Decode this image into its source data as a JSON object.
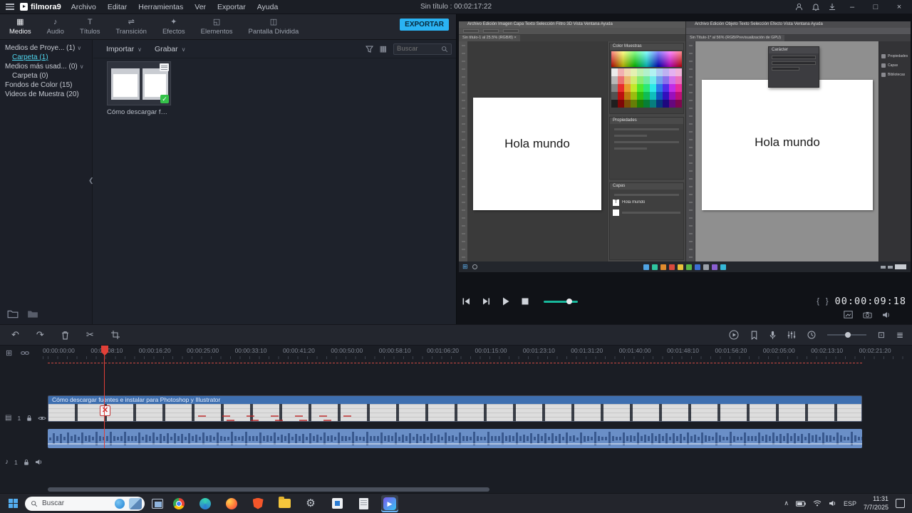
{
  "colors": {
    "accent": "#2ab3f3",
    "selection": "#4fd6ee",
    "playhead_red": "#e04038",
    "clip_label_bg": "#3e6fb0",
    "audio_clip": "#6a8fc7",
    "taskbar_bg": "#23252c"
  },
  "menubar": {
    "logo": "filmora9",
    "menus": [
      "Archivo",
      "Editar",
      "Herramientas",
      "Ver",
      "Exportar",
      "Ayuda"
    ],
    "title": "Sin título : 00:02:17:22",
    "window_buttons": {
      "minimize": "–",
      "maximize": "□",
      "close": "×"
    }
  },
  "tabbar": {
    "tabs": [
      {
        "icon": "▦",
        "label": "Medios"
      },
      {
        "icon": "♪",
        "label": "Audio"
      },
      {
        "icon": "T",
        "label": "Títulos"
      },
      {
        "icon": "⇌",
        "label": "Transición"
      },
      {
        "icon": "✦",
        "label": "Efectos"
      },
      {
        "icon": "◱",
        "label": "Elementos"
      },
      {
        "icon": "◫",
        "label": "Pantalla Dividida"
      }
    ],
    "export_label": "EXPORTAR"
  },
  "media": {
    "sidebar": {
      "project_media": "Medios de Proye... (1)",
      "folder1": "Carpeta (1)",
      "most_used": "Medios más usad... (0)",
      "folder0": "Carpeta (0)",
      "color_backgrounds": "Fondos de Color (15)",
      "sample_videos": "Videos de Muestra (20)"
    },
    "import_label": "Importar",
    "record_label": "Grabar",
    "search_placeholder": "Buscar",
    "item_label": "Cómo descargar fuente..."
  },
  "preview": {
    "timecode": "00:00:09:18"
  },
  "video_content": {
    "ps_menu": "Archivo   Edición   Imagen   Capa   Texto   Selección   Filtro   3D   Vista   Ventana   Ayuda",
    "ps_tab": "Sin título-1 al 25.5% (RGB/8) ×",
    "ps_canvas_text": "Hola mundo",
    "ps_swatches_tabs": "Color   Muestras",
    "ps_properties": "Propiedades",
    "ps_layers": "Capas",
    "ps_layer_name": "Hola mundo",
    "ai_menu": "Archivo   Edición   Objeto   Texto   Selección   Efecto   Vista   Ventana   Ayuda",
    "ai_tab": "Sin Título-1* al 56% (RGB/Previsualización de GPU)",
    "ai_canvas_text": "Hola mundo",
    "ai_character_panel": "Carácter",
    "ai_dock": [
      "Propiedades",
      "Capas",
      "Bibliotecas"
    ]
  },
  "timeline": {
    "ruler_labels": [
      "00:00:00:00",
      "00:00:08:10",
      "00:00:16:20",
      "00:00:25:00",
      "00:00:33:10",
      "00:00:41:20",
      "00:00:50:00",
      "00:00:58:10",
      "00:01:06:20",
      "00:01:15:00",
      "00:01:23:10",
      "00:01:31:20",
      "00:01:40:00",
      "00:01:48:10",
      "00:01:56:20",
      "00:02:05:00",
      "00:02:13:10",
      "00:02:21:20"
    ],
    "clip_label": "Cómo descargar fuentes e instalar para Photoshop y Illustrator",
    "video_track_number": "1",
    "audio_track_number": "1"
  },
  "taskbar": {
    "search_placeholder": "Buscar",
    "language": "ESP",
    "time": "11:31",
    "date": "7/7/2025"
  }
}
